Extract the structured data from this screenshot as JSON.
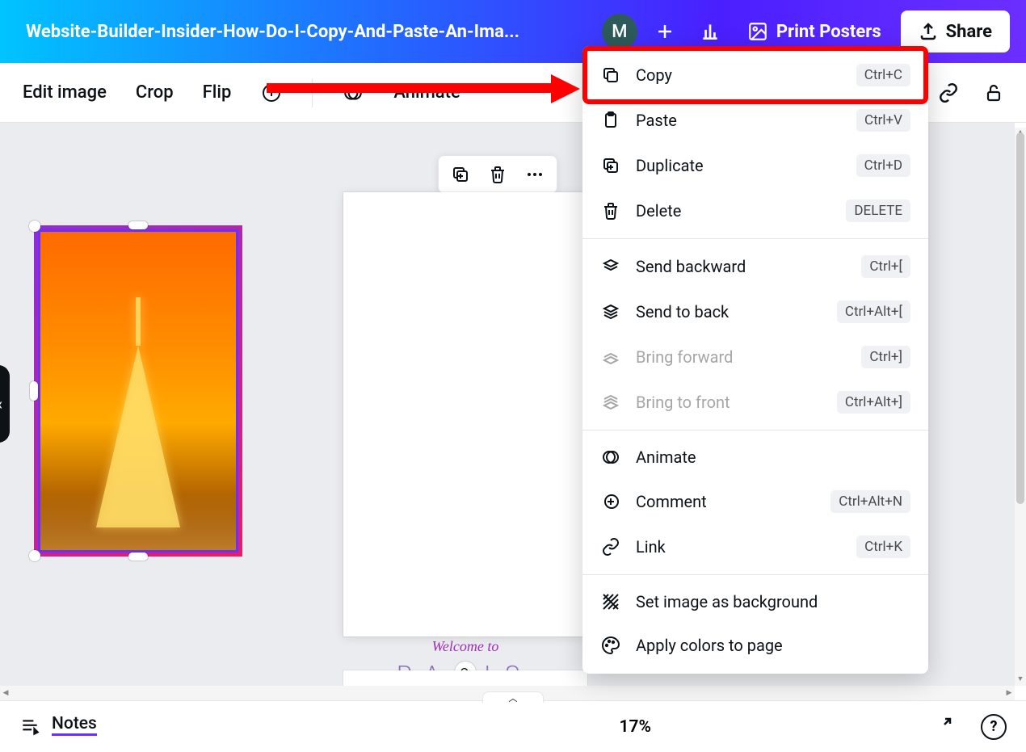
{
  "header": {
    "doc_title": "Website-Builder-Insider-How-Do-I-Copy-And-Paste-An-Ima...",
    "avatar_initial": "M",
    "print_label": "Print Posters",
    "share_label": "Share"
  },
  "toolbar": {
    "edit_image": "Edit image",
    "crop": "Crop",
    "flip": "Flip",
    "animate": "Animate"
  },
  "canvas": {
    "welcome_text": "Welcome to",
    "paris_text": "PARIS"
  },
  "context_menu": {
    "items": [
      {
        "label": "Copy",
        "shortcut": "Ctrl+C",
        "icon": "copy"
      },
      {
        "label": "Paste",
        "shortcut": "Ctrl+V",
        "icon": "paste"
      },
      {
        "label": "Duplicate",
        "shortcut": "Ctrl+D",
        "icon": "duplicate"
      },
      {
        "label": "Delete",
        "shortcut": "DELETE",
        "icon": "delete"
      }
    ],
    "layer_items": [
      {
        "label": "Send backward",
        "shortcut": "Ctrl+[",
        "icon": "send-backward",
        "disabled": false
      },
      {
        "label": "Send to back",
        "shortcut": "Ctrl+Alt+[",
        "icon": "send-back",
        "disabled": false
      },
      {
        "label": "Bring forward",
        "shortcut": "Ctrl+]",
        "icon": "bring-forward",
        "disabled": true
      },
      {
        "label": "Bring to front",
        "shortcut": "Ctrl+Alt+]",
        "icon": "bring-front",
        "disabled": true
      }
    ],
    "extra_items": [
      {
        "label": "Animate",
        "shortcut": "",
        "icon": "animate"
      },
      {
        "label": "Comment",
        "shortcut": "Ctrl+Alt+N",
        "icon": "comment"
      },
      {
        "label": "Link",
        "shortcut": "Ctrl+K",
        "icon": "link"
      }
    ],
    "bg_items": [
      {
        "label": "Set image as background",
        "shortcut": "",
        "icon": "set-bg"
      },
      {
        "label": "Apply colors to page",
        "shortcut": "",
        "icon": "palette"
      }
    ]
  },
  "bottom": {
    "notes": "Notes",
    "zoom": "17%"
  }
}
